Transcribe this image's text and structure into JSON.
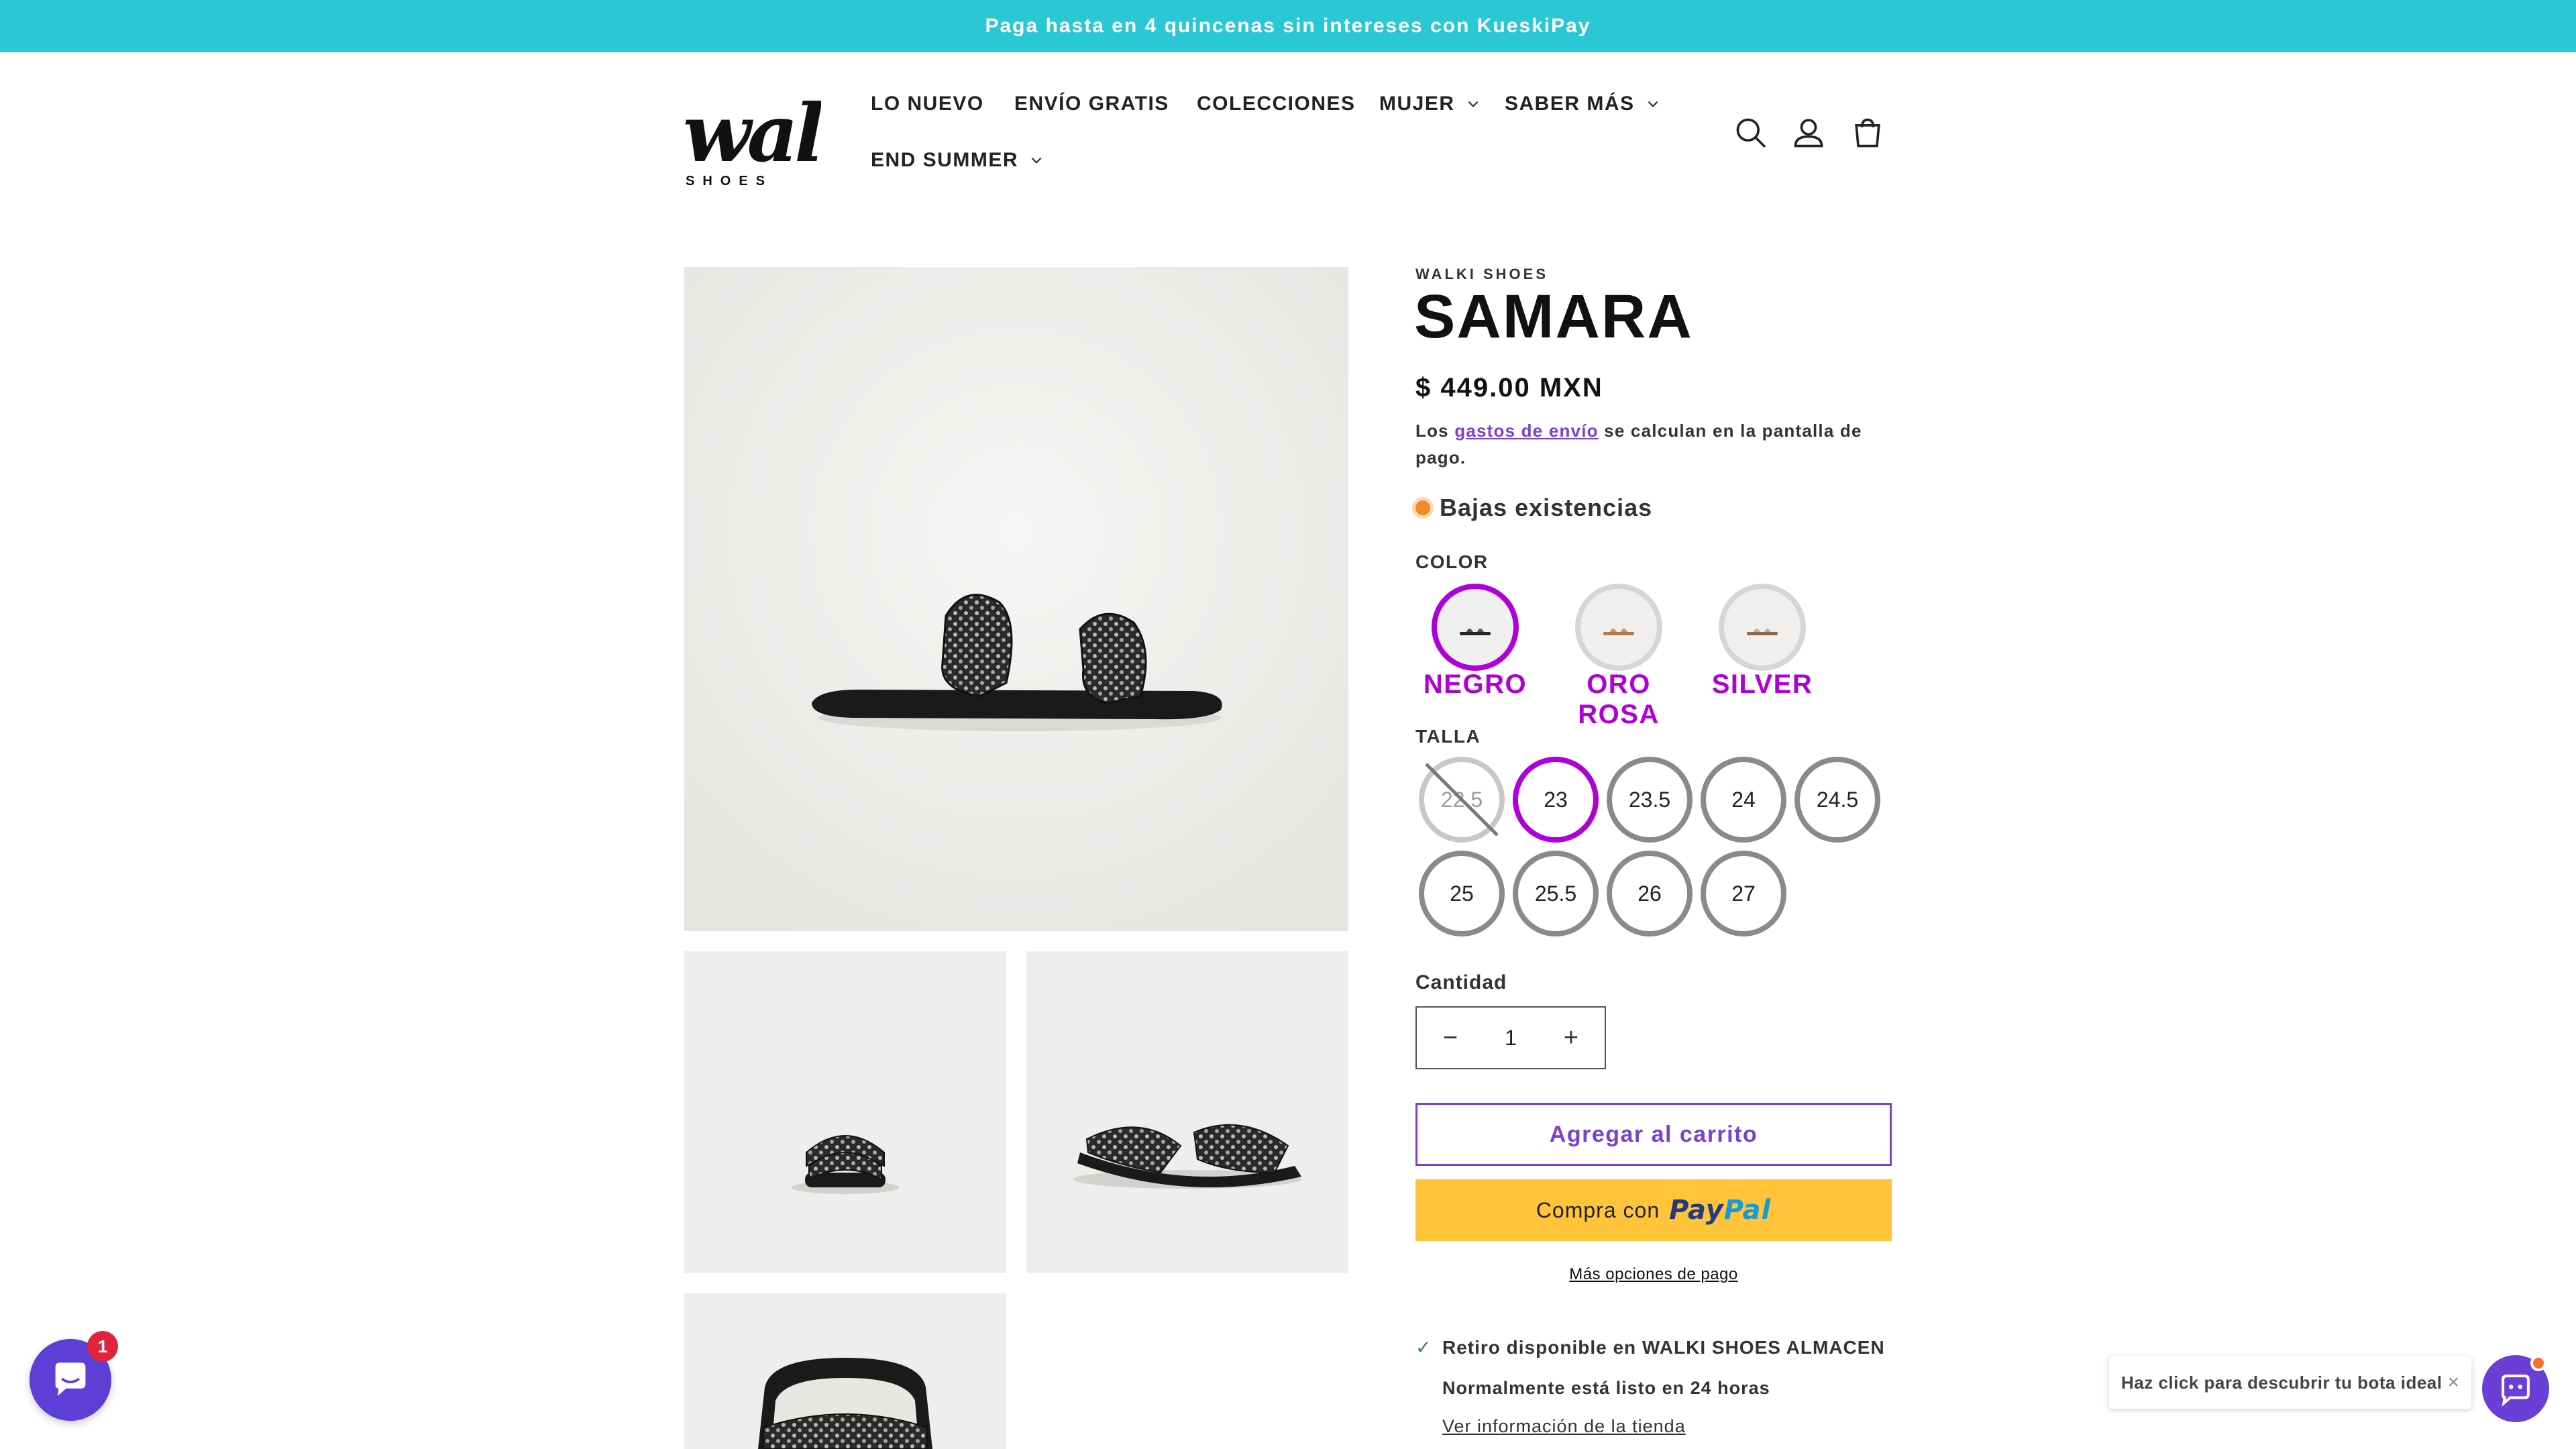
{
  "announcement": "Paga hasta en 4 quincenas sin intereses con KueskiPay",
  "logo": {
    "text": "walki",
    "sub": "SHOES"
  },
  "nav": [
    {
      "label": "LO NUEVO",
      "dropdown": false
    },
    {
      "label": "ENVÍO GRATIS",
      "dropdown": false
    },
    {
      "label": "COLECCIONES",
      "dropdown": false
    },
    {
      "label": "MUJER",
      "dropdown": true
    },
    {
      "label": "SABER MÁS",
      "dropdown": true
    },
    {
      "label": "END SUMMER",
      "dropdown": true
    }
  ],
  "header_icons": [
    "search-icon",
    "account-icon",
    "cart-icon"
  ],
  "product": {
    "vendor": "WALKI SHOES",
    "title": "SAMARA",
    "price": "$ 449.00 MXN",
    "shipping_note_pre": "Los ",
    "shipping_note_link": "gastos de envío",
    "shipping_note_post": " se calculan en la pantalla de pago.",
    "stock": "Bajas existencias"
  },
  "color": {
    "label": "COLOR",
    "options": [
      {
        "name": "NEGRO",
        "selected": true
      },
      {
        "name": "ORO ROSA",
        "selected": false
      },
      {
        "name": "SILVER",
        "selected": false
      }
    ]
  },
  "size": {
    "label": "TALLA",
    "options": [
      {
        "value": "22.5",
        "available": false,
        "selected": false
      },
      {
        "value": "23",
        "available": true,
        "selected": true
      },
      {
        "value": "23.5",
        "available": true,
        "selected": false
      },
      {
        "value": "24",
        "available": true,
        "selected": false
      },
      {
        "value": "24.5",
        "available": true,
        "selected": false
      },
      {
        "value": "25",
        "available": true,
        "selected": false
      },
      {
        "value": "25.5",
        "available": true,
        "selected": false
      },
      {
        "value": "26",
        "available": true,
        "selected": false
      },
      {
        "value": "27",
        "available": true,
        "selected": false
      }
    ]
  },
  "quantity": {
    "label": "Cantidad",
    "value": "1",
    "minus": "−",
    "plus": "+"
  },
  "buttons": {
    "add_to_cart": "Agregar al carrito",
    "paypal_prefix": "Compra con",
    "paypal_logo_1": "Pay",
    "paypal_logo_2": "Pal",
    "more_payment": "Más opciones de pago"
  },
  "pickup": {
    "check": "✓",
    "line_pre": "Retiro disponible en ",
    "line_store": "WALKI SHOES ALMACEN",
    "ready": "Normalmente está listo en 24 horas",
    "store_link": "Ver información de la tienda"
  },
  "chat": {
    "badge": "1"
  },
  "quiz_bubble": {
    "text": "Haz click para descubrir tu bota ideal",
    "close": "×"
  },
  "colors": {
    "accent": "#b000d8",
    "purple": "#7b3fd1",
    "banner": "#2ac8d4",
    "paypal": "#ffc43a"
  }
}
